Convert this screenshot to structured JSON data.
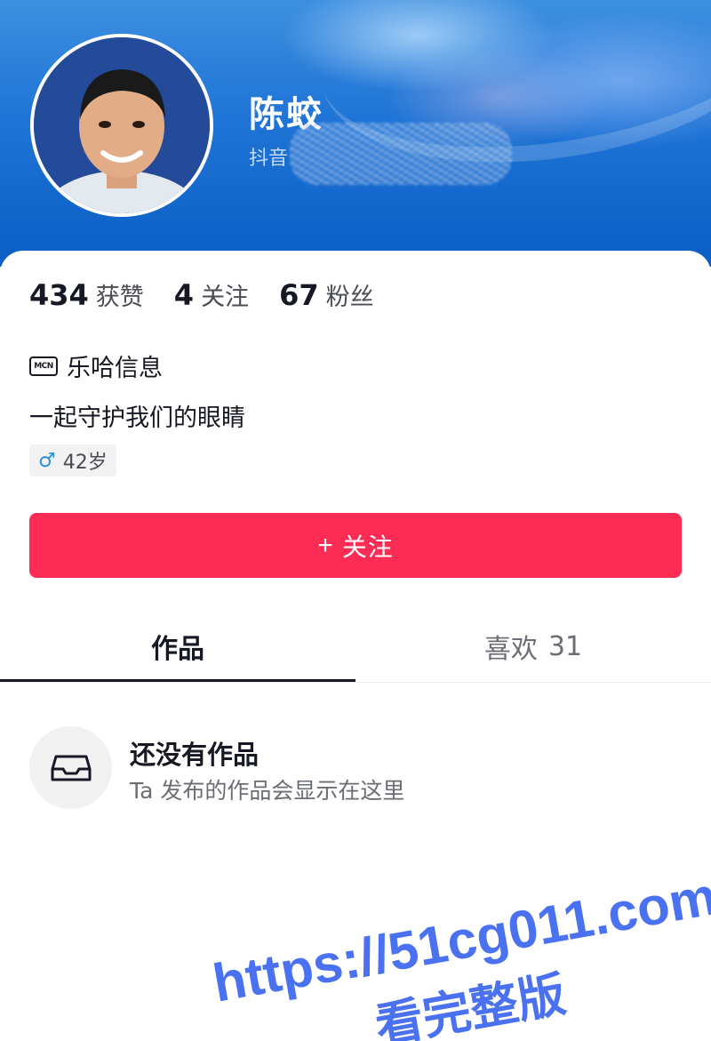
{
  "profile": {
    "nickname": "陈蛟",
    "douyin_id_prefix": "抖音"
  },
  "stats": [
    {
      "value": "434",
      "label": "获赞"
    },
    {
      "value": "4",
      "label": "关注"
    },
    {
      "value": "67",
      "label": "粉丝"
    }
  ],
  "mcn": {
    "icon_text": "MCN",
    "name": "乐哈信息"
  },
  "signature": "一起守护我们的眼睛",
  "gender_tag": {
    "symbol": "♂",
    "age": "42岁"
  },
  "follow_button": {
    "plus": "+",
    "label": "关注"
  },
  "tabs": {
    "works": "作品",
    "likes": "喜欢",
    "likes_count": "31"
  },
  "empty_state": {
    "title": "还没有作品",
    "subtitle": "Ta 发布的作品会显示在这里"
  },
  "watermark": {
    "line1": "https://51cg011.com",
    "line2": "看完整版"
  },
  "colors": {
    "accent": "#fe2c55",
    "header_blue": "#1f74d6",
    "watermark_blue": "#4a72f0"
  }
}
